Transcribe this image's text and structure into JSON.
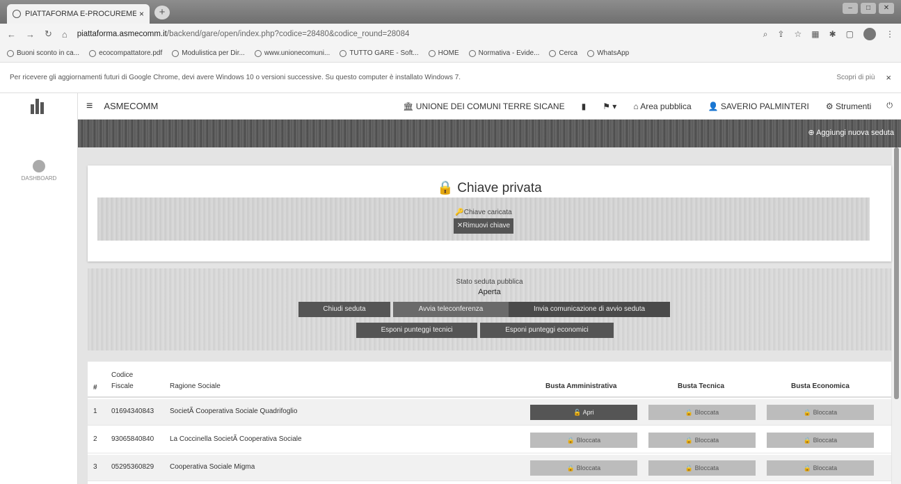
{
  "browser": {
    "tab_title": "PIATTAFORMA E-PROCUREMENT",
    "tab_close": "×",
    "new_tab": "+",
    "url_host": "piattaforma.asmecomm.it",
    "url_path": "/backend/gare/open/index.php?codice=28480&codice_round=28084",
    "bookmarks": [
      "Buoni sconto in ca...",
      "ecocompattatore.pdf",
      "Modulistica per Dir...",
      "www.unionecomuni...",
      "TUTTO GARE - Soft...",
      "HOME",
      "Normativa - Evide...",
      "Cerca",
      "WhatsApp"
    ],
    "infobar_msg": "Per ricevere gli aggiornamenti futuri di Google Chrome, devi avere Windows 10 o versioni successive. Su questo computer è installato Windows 7.",
    "infobar_more": "Scopri di più",
    "infobar_close": "×"
  },
  "sidebar": {
    "dashboard_label": "DASHBOARD"
  },
  "topnav": {
    "brand": "ASMECOMM",
    "ente": "UNIONE DEI COMUNI TERRE SICANE",
    "area": "Area pubblica",
    "user": "SAVERIO PALMINTERI",
    "tools": "Strumenti"
  },
  "banner": {
    "add_label": "Aggiungi nuova seduta"
  },
  "key_card": {
    "title": "Chiave privata",
    "status": "Chiave caricata",
    "remove_btn": "Rimuovi chiave"
  },
  "session": {
    "label": "Stato seduta pubblica",
    "state": "Aperta",
    "buttons": [
      "Chiudi seduta",
      "Avvia teleconferenza",
      "Invia comunicazione di avvio seduta",
      "Esponi punteggi tecnici",
      "Esponi punteggi economici"
    ]
  },
  "table": {
    "headers": {
      "num": "#",
      "cf1": "Codice",
      "cf2": "Fiscale",
      "ragione": "Ragione Sociale",
      "amm": "Busta Amministrativa",
      "tec": "Busta Tecnica",
      "eco": "Busta Economica"
    },
    "rows": [
      {
        "n": "1",
        "cf": "01694340843",
        "ragione": "SocietÃ  Cooperativa Sociale Quadrifoglio",
        "amm": "Apri",
        "tec": "Bloccata",
        "eco": "Bloccata"
      },
      {
        "n": "2",
        "cf": "93065840840",
        "ragione": "La Coccinella SocietÃ  Cooperativa Sociale",
        "amm": "Bloccata",
        "tec": "Bloccata",
        "eco": "Bloccata"
      },
      {
        "n": "3",
        "cf": "05295360829",
        "ragione": "Cooperativa Sociale Migma",
        "amm": "Bloccata",
        "tec": "Bloccata",
        "eco": "Bloccata"
      }
    ]
  }
}
